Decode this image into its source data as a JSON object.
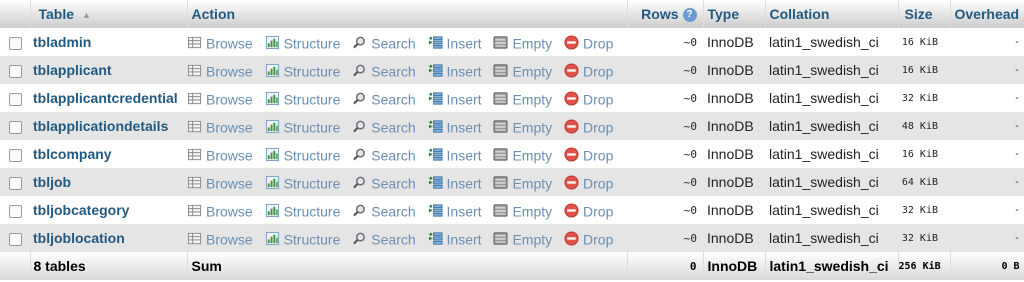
{
  "header": {
    "table": "Table",
    "action": "Action",
    "rows": "Rows",
    "type": "Type",
    "collation": "Collation",
    "size": "Size",
    "overhead": "Overhead"
  },
  "actions": {
    "browse": "Browse",
    "structure": "Structure",
    "search": "Search",
    "insert": "Insert",
    "empty": "Empty",
    "drop": "Drop"
  },
  "rows": [
    {
      "name": "tbladmin",
      "rows": "~0",
      "type": "InnoDB",
      "collation": "latin1_swedish_ci",
      "size": "16 KiB",
      "overhead": "-"
    },
    {
      "name": "tblapplicant",
      "rows": "~0",
      "type": "InnoDB",
      "collation": "latin1_swedish_ci",
      "size": "16 KiB",
      "overhead": "-"
    },
    {
      "name": "tblapplicantcredential",
      "rows": "~0",
      "type": "InnoDB",
      "collation": "latin1_swedish_ci",
      "size": "32 KiB",
      "overhead": "-"
    },
    {
      "name": "tblapplicationdetails",
      "rows": "~0",
      "type": "InnoDB",
      "collation": "latin1_swedish_ci",
      "size": "48 KiB",
      "overhead": "-"
    },
    {
      "name": "tblcompany",
      "rows": "~0",
      "type": "InnoDB",
      "collation": "latin1_swedish_ci",
      "size": "16 KiB",
      "overhead": "-"
    },
    {
      "name": "tbljob",
      "rows": "~0",
      "type": "InnoDB",
      "collation": "latin1_swedish_ci",
      "size": "64 KiB",
      "overhead": "-"
    },
    {
      "name": "tbljobcategory",
      "rows": "~0",
      "type": "InnoDB",
      "collation": "latin1_swedish_ci",
      "size": "32 KiB",
      "overhead": "-"
    },
    {
      "name": "tbljoblocation",
      "rows": "~0",
      "type": "InnoDB",
      "collation": "latin1_swedish_ci",
      "size": "32 KiB",
      "overhead": "-"
    }
  ],
  "footer": {
    "count": "8 tables",
    "sum": "Sum",
    "rows": "0",
    "type": "InnoDB",
    "collation": "latin1_swedish_ci",
    "size": "256 KiB",
    "overhead": "0 B"
  },
  "colors": {
    "link": "#235a81",
    "drop_icon": "#e0534a",
    "row_alt": "#e5e5e5"
  },
  "icons": {
    "browse": "table-grid-icon",
    "structure": "structure-icon",
    "search": "magnifier-icon",
    "insert": "insert-row-icon",
    "empty": "empty-table-icon",
    "drop": "drop-icon"
  }
}
